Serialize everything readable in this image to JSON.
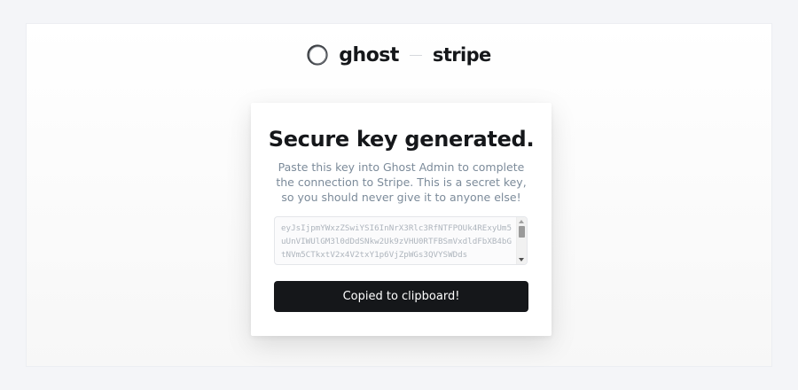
{
  "header": {
    "ghost_logo_text": "ghost",
    "stripe_logo_text": "stripe"
  },
  "card": {
    "title": "Secure key generated.",
    "description": "Paste this key into Ghost Admin to complete the connection to Stripe. This is a secret key, so you should never give it to anyone else!",
    "secret_key": "eyJsIjpmYWxzZSwiYSI6InNrX3Rlc3RfNTFPOUk4RExyUm5uUnVIWUlGM3l0dDdSNkw2Uk9zVHU0RTFBSmVxdldFbXB4bGtNVm5CTkxtV2x4V2txY1p6VjZpWGs3QVYSWDds",
    "copy_button_label": "Copied to clipboard!"
  },
  "colors": {
    "background": "#f4f5f8",
    "button": "#15171a",
    "muted_text": "#7c8b9a"
  }
}
